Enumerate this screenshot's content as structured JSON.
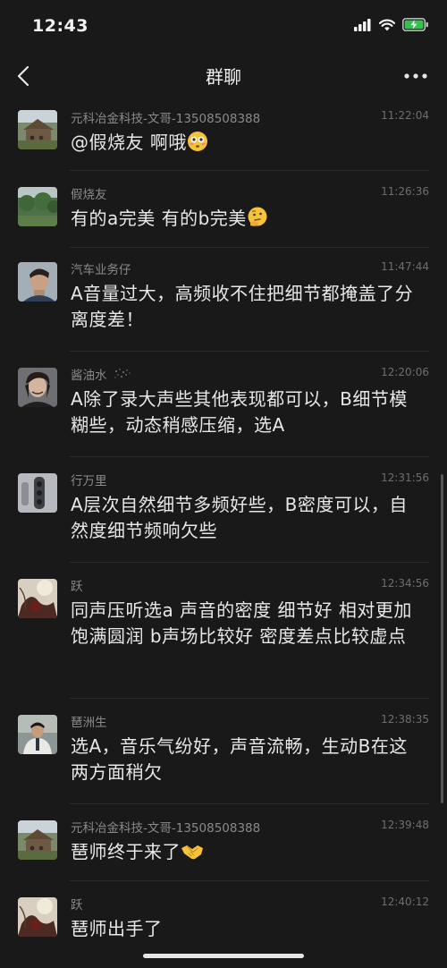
{
  "status_bar": {
    "time": "12:43",
    "signal_icon": "cellular-signal-icon",
    "wifi_icon": "wifi-icon",
    "battery_icon": "battery-charging-icon",
    "battery_color": "#33c24d"
  },
  "nav": {
    "title": "群聊",
    "back_icon": "chevron-left-icon",
    "more_icon": "more-dots-icon"
  },
  "messages": [
    {
      "sender": "元科冶金科技-文哥-13508508388",
      "time": "11:22:04",
      "text": "@假烧友  啊哦",
      "emoji": "flushed-face-emoji"
    },
    {
      "sender": "假烧友",
      "time": "11:26:36",
      "text": "有的a完美 有的b完美",
      "emoji": "thinking-face-emoji"
    },
    {
      "sender": "汽车业务仔",
      "time": "11:47:44",
      "text": "A音量过大，高频收不住把细节都掩盖了分离度差！"
    },
    {
      "sender": "酱油水",
      "time": "12:20:06",
      "text": "A除了录大声些其他表现都可以，B细节模糊些，动态稍感压缩，选A"
    },
    {
      "sender": "行万里",
      "time": "12:31:56",
      "text": "A层次自然细节多频好些，B密度可以，自然度细节频响欠些"
    },
    {
      "sender": "跃",
      "time": "12:34:56",
      "text": "同声压听选a  声音的密度 细节好 相对更加饱满圆润 b声场比较好 密度差点比较虚点"
    },
    {
      "sender": "琶洲生",
      "time": "12:38:35",
      "text": "选A，音乐气纷好，声音流畅，生动B在这两方面稍欠"
    },
    {
      "sender": "元科冶金科技-文哥-13508508388",
      "time": "12:39:48",
      "text": "琶师终于来了",
      "emoji": "handshake-emoji"
    },
    {
      "sender": "跃",
      "time": "12:40:12",
      "text": "琶师出手了"
    }
  ]
}
